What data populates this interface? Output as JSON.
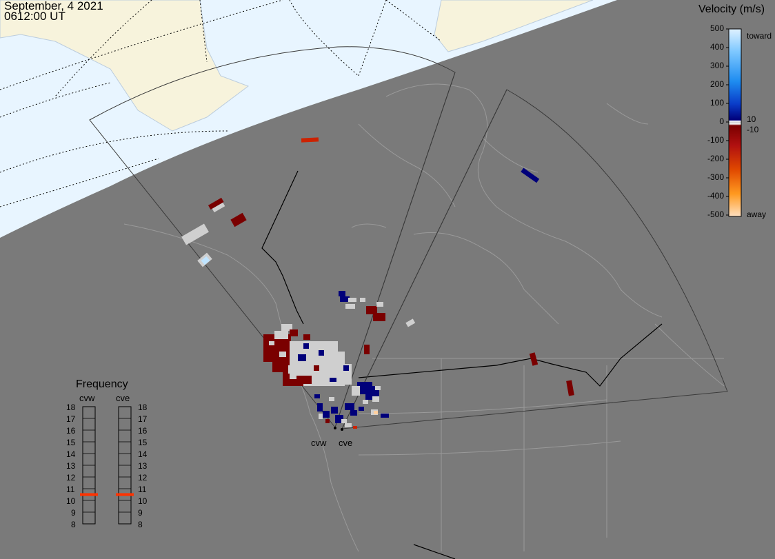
{
  "header": {
    "date": "September, 4 2021",
    "time": "0612:00 UT"
  },
  "colorbar": {
    "title": "Velocity (m/s)",
    "ticks": [
      "500",
      "400",
      "300",
      "200",
      "100",
      "0",
      "-100",
      "-200",
      "-300",
      "-400",
      "-500"
    ],
    "extra_ticks": [
      "10",
      "-10"
    ],
    "toward_label": "toward",
    "away_label": "away",
    "colors": {
      "toward_high": "#dff1ff",
      "toward_mid": "#1e8cf0",
      "toward_low": "#00007a",
      "away_low": "#800000",
      "away_mid": "#e06000",
      "away_high": "#ffe0c0",
      "ground_scatter": "#cfcfcf"
    }
  },
  "frequency_panel": {
    "title": "Frequency",
    "radars": [
      {
        "name": "cvw",
        "frequency_mhz": 10.5
      },
      {
        "name": "cve",
        "frequency_mhz": 10.5
      }
    ],
    "scale": [
      "18",
      "17",
      "16",
      "15",
      "14",
      "13",
      "12",
      "11",
      "10",
      "9",
      "8"
    ],
    "marker_color": "#ff3300"
  },
  "map": {
    "radar_sites": [
      "cvw",
      "cve"
    ],
    "land_color": "#f5f2dc",
    "daylight_color": "#e8f5ff",
    "night_color": "#7a7a7a"
  }
}
